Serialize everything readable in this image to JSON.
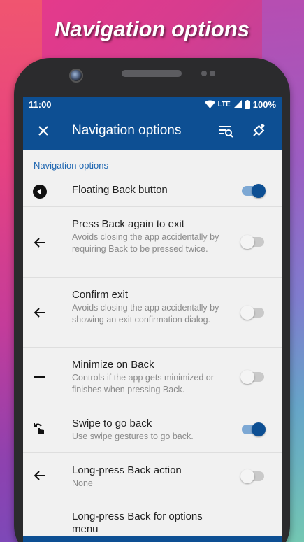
{
  "headline": "Navigation options",
  "status": {
    "time": "11:00",
    "network": "LTE",
    "battery": "100%"
  },
  "appbar": {
    "title": "Navigation options",
    "close_icon": "close-icon",
    "filter_icon": "filter-search-icon",
    "extra_icon": "satellite-icon"
  },
  "section": {
    "header": "Navigation options"
  },
  "rows": [
    {
      "title": "Floating Back button",
      "subtitle": "",
      "icon": "back-circle-icon",
      "enabled": true
    },
    {
      "title": "Press Back again to exit",
      "subtitle": "Avoids closing the app accidentally by requiring Back to be pressed twice.",
      "icon": "arrow-left-icon",
      "enabled": false
    },
    {
      "title": "Confirm exit",
      "subtitle": "Avoids closing the app accidentally by showing an exit confirmation dialog.",
      "icon": "arrow-left-icon",
      "enabled": false
    },
    {
      "title": "Minimize on Back",
      "subtitle": "Controls if the app gets minimized or finishes when pressing Back.",
      "icon": "minus-icon",
      "enabled": false
    },
    {
      "title": "Swipe to go back",
      "subtitle": "Use swipe gestures to go back.",
      "icon": "swipe-gesture-icon",
      "enabled": true
    },
    {
      "title": "Long-press Back action",
      "subtitle": "None",
      "icon": "arrow-left-icon",
      "enabled": false
    },
    {
      "title": "Long-press Back for options menu",
      "subtitle": "",
      "icon": "",
      "enabled": false
    }
  ],
  "colors": {
    "primary": "#0d4f93",
    "accent_text": "#1b64b0",
    "switch_on_track": "#7da8d4"
  }
}
